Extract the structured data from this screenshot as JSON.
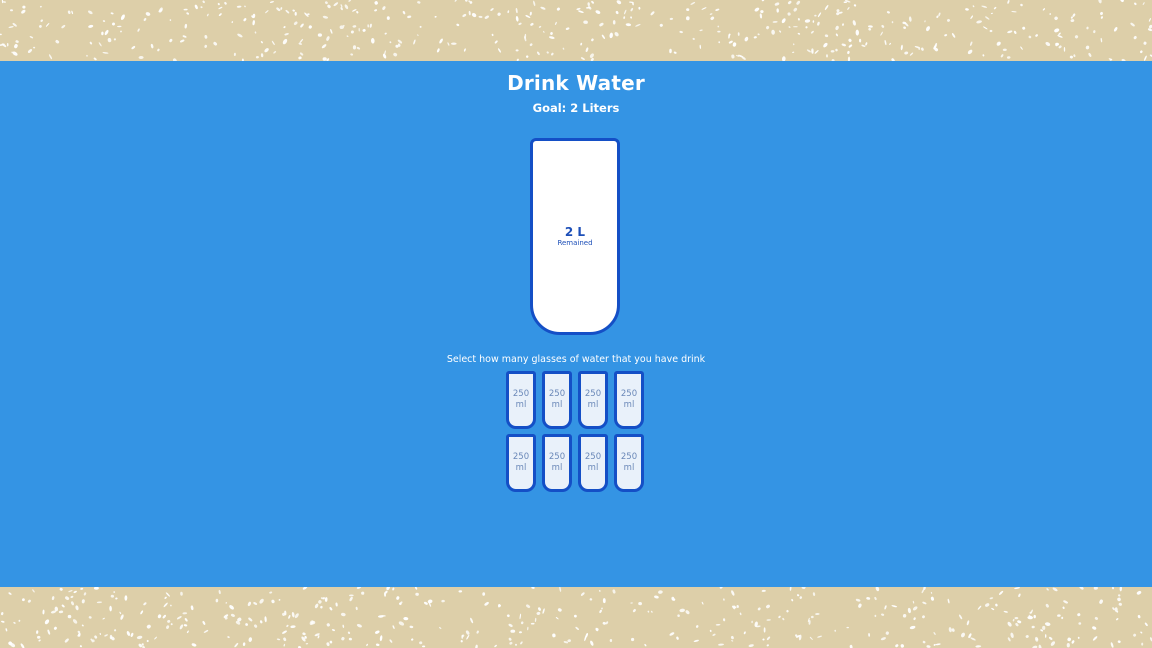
{
  "app": {
    "title": "Drink Water",
    "goal_text": "Goal: 2 Liters",
    "instruction": "Select how many glasses of water that you have drink"
  },
  "big_cup": {
    "remained_amount": "2 L",
    "remained_label": "Remained",
    "filled_fraction": 0,
    "percentage_text": ""
  },
  "small_cups": [
    {
      "label": "250 ml",
      "selected": false
    },
    {
      "label": "250 ml",
      "selected": false
    },
    {
      "label": "250 ml",
      "selected": false
    },
    {
      "label": "250 ml",
      "selected": false
    },
    {
      "label": "250 ml",
      "selected": false
    },
    {
      "label": "250 ml",
      "selected": false
    },
    {
      "label": "250 ml",
      "selected": false
    },
    {
      "label": "250 ml",
      "selected": false
    }
  ],
  "colors": {
    "stage_background": "#3494e4",
    "cup_border": "#144fc6",
    "border_pattern": "#ddcfa9"
  }
}
